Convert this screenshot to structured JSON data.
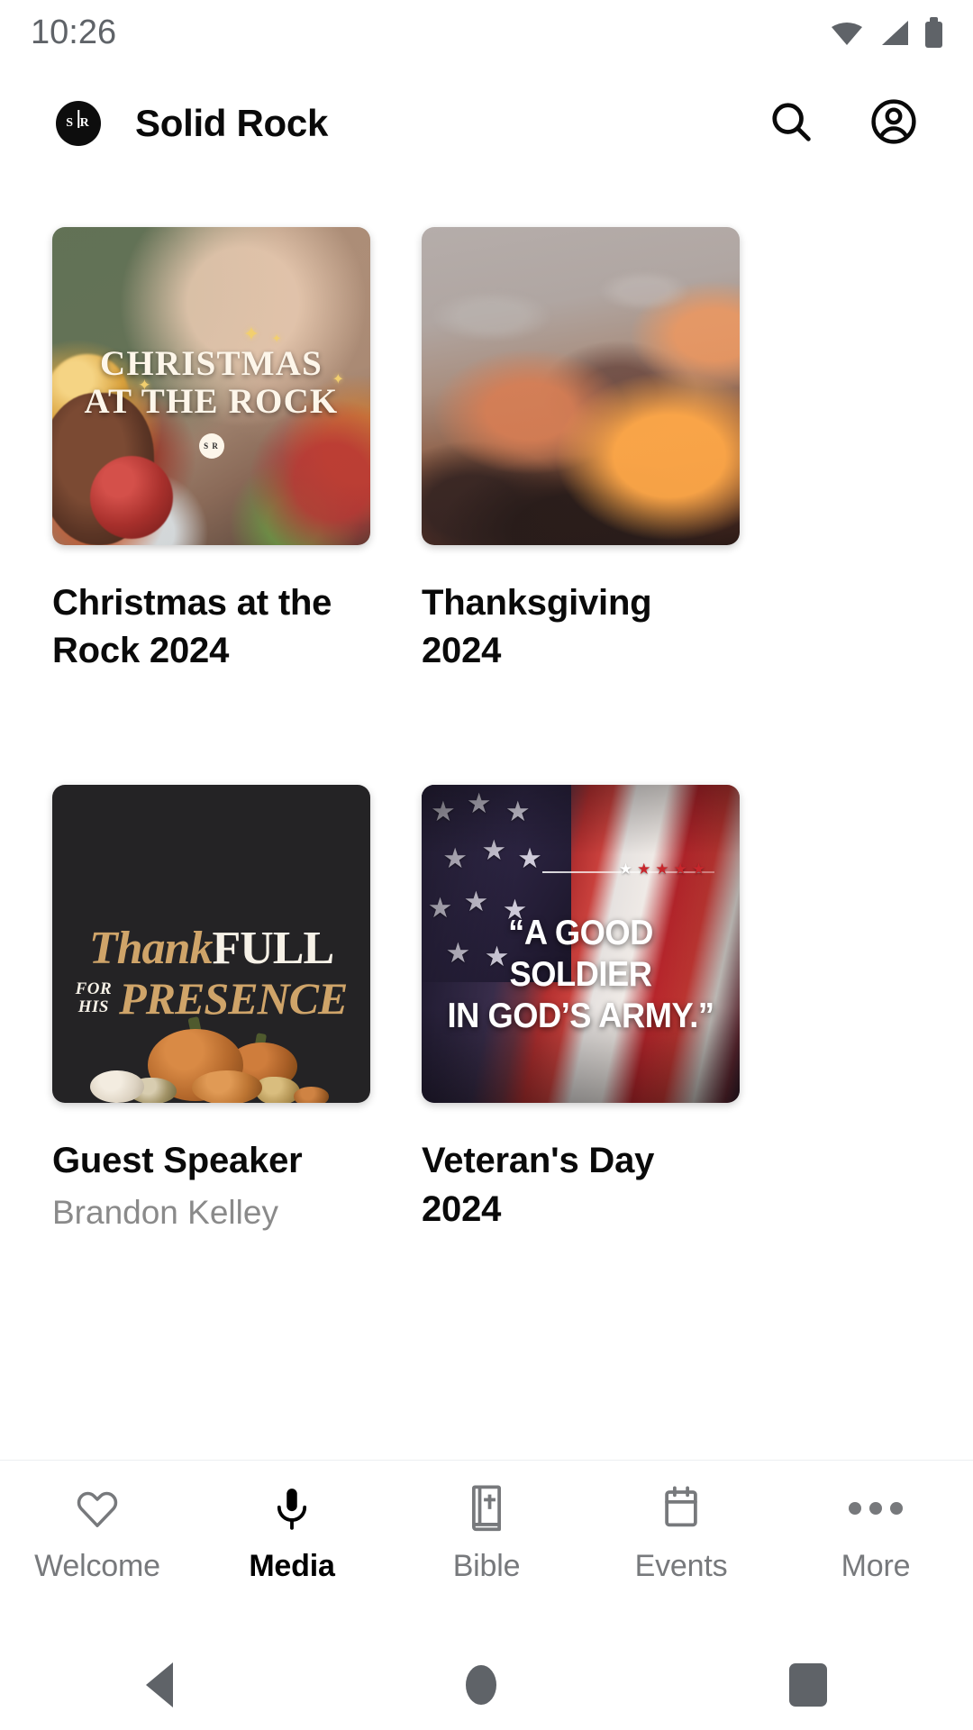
{
  "status_bar": {
    "time": "10:26",
    "icons": [
      "wifi-icon",
      "cellular-signal-icon",
      "battery-icon"
    ]
  },
  "app_bar": {
    "logo_text": "S R",
    "title": "Solid Rock",
    "actions": [
      {
        "name": "search-icon",
        "label": "Search"
      },
      {
        "name": "account-icon",
        "label": "Account"
      }
    ]
  },
  "media_grid": {
    "items": [
      {
        "title": "Christmas at the Rock 2024",
        "subtitle": "",
        "art": {
          "kind": "christmas-bokeh",
          "overlay_line1": "CHRISTMAS",
          "overlay_line2": "AT THE ROCK",
          "badge": "S R"
        }
      },
      {
        "title": "Thanksgiving 2024",
        "subtitle": "",
        "art": {
          "kind": "sunset-clouds",
          "overlay_line1": "",
          "overlay_line2": ""
        }
      },
      {
        "title": "Guest Speaker",
        "subtitle": "Brandon Kelley",
        "art": {
          "kind": "thankfull-pumpkins",
          "word_gold": "Thank",
          "word_white": "FULL",
          "small_line1": "FOR",
          "small_line2": "HIS",
          "word_presence": "PRESENCE"
        }
      },
      {
        "title": "Veteran's Day 2024",
        "subtitle": "",
        "art": {
          "kind": "american-flag",
          "quote_line1": "“A GOOD SOLDIER",
          "quote_line2": "IN GOD’S ARMY.”"
        }
      }
    ]
  },
  "bottom_nav": {
    "items": [
      {
        "label": "Welcome",
        "icon": "heart-icon",
        "active": false
      },
      {
        "label": "Media",
        "icon": "microphone-icon",
        "active": true
      },
      {
        "label": "Bible",
        "icon": "bible-book-icon",
        "active": false
      },
      {
        "label": "Events",
        "icon": "calendar-icon",
        "active": false
      },
      {
        "label": "More",
        "icon": "overflow-dots-icon",
        "active": false
      }
    ]
  },
  "system_nav": {
    "back": "back-button",
    "home": "home-button",
    "recents": "recents-button"
  },
  "colors": {
    "accent_black": "#0a0a0a",
    "muted_text": "#8a8a8a",
    "nav_inactive": "#77797c",
    "gold": "#cfa469",
    "card_dark": "#242325"
  }
}
